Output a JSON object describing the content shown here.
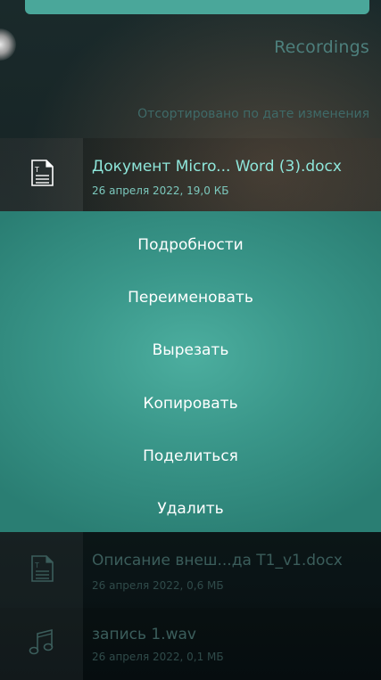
{
  "header": {
    "title": "Recordings",
    "sort_label": "Отсортировано по дате изменения"
  },
  "files": [
    {
      "name": "Документ Micro... Word (3).docx",
      "meta": "26 апреля 2022, 19,0 КБ",
      "icon": "document-icon",
      "selected": true
    },
    {
      "name": "Описание внеш...да T1_v1.docx",
      "meta": "26 апреля 2022, 0,6 МБ",
      "icon": "document-icon",
      "selected": false
    },
    {
      "name": "запись 1.wav",
      "meta": "26 апреля 2022, 0,1 МБ",
      "icon": "music-note-icon",
      "selected": false
    }
  ],
  "context_menu": {
    "items": [
      "Подробности",
      "Переименовать",
      "Вырезать",
      "Копировать",
      "Поделиться",
      "Удалить"
    ]
  },
  "colors": {
    "accent": "#4aa79a",
    "selected_text": "#8ee6da",
    "menu_bg": "#3a978a"
  }
}
